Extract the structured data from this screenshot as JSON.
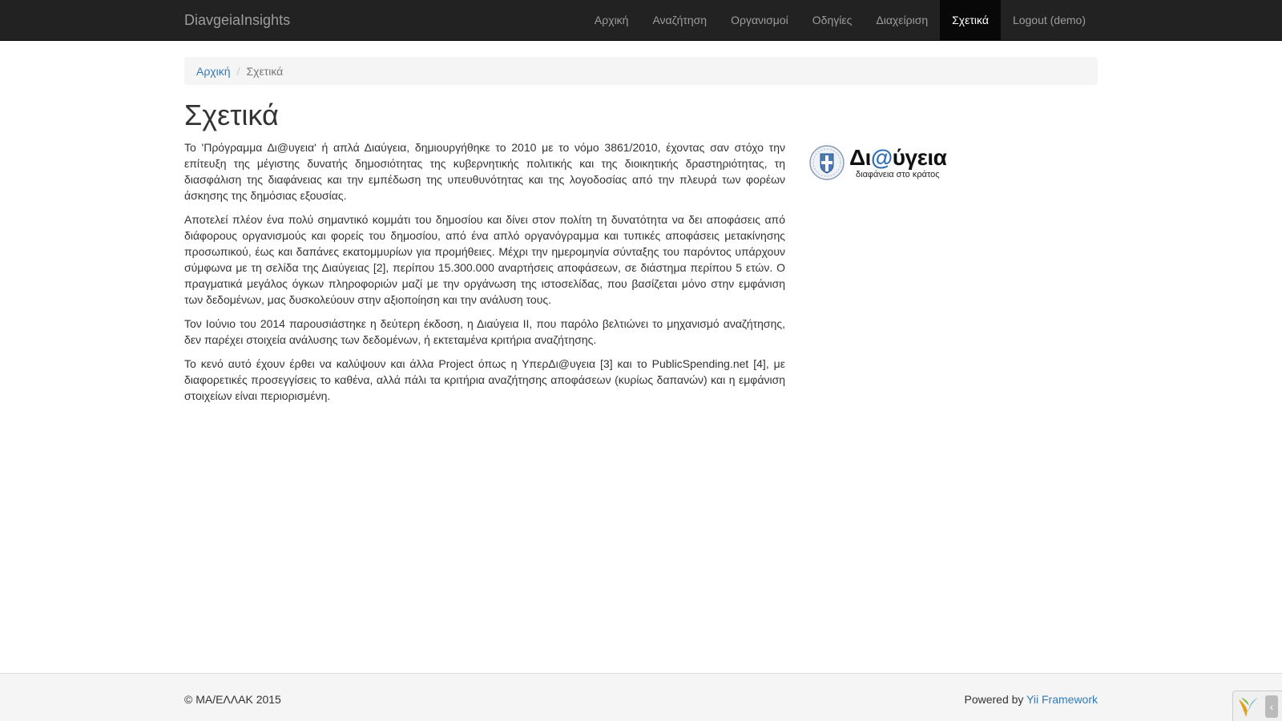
{
  "navbar": {
    "brand": "DiavgeiaInsights",
    "items": [
      {
        "label": "Αρχική",
        "active": false
      },
      {
        "label": "Αναζήτηση",
        "active": false
      },
      {
        "label": "Οργανισμοί",
        "active": false
      },
      {
        "label": "Οδηγίες",
        "active": false
      },
      {
        "label": "Διαχείριση",
        "active": false
      },
      {
        "label": "Σχετικά",
        "active": true
      },
      {
        "label": "Logout (demo)",
        "active": false
      }
    ]
  },
  "breadcrumb": {
    "home": "Αρχική",
    "separator": "/",
    "current": "Σχετικά"
  },
  "page": {
    "title": "Σχετικά",
    "paragraphs": [
      "Το 'Πρόγραμμα Δι@υγεια' ή απλά Διαύγεια, δημιουργήθηκε το 2010 με το νόμο 3861/2010, έχοντας σαν στόχο την επίτευξη της μέγιστης δυνατής δημοσιότητας της κυβερνητικής πολιτικής και της διοικητικής δραστηριότητας, τη διασφάλιση της διαφάνειας και την εμπέδωση της υπευθυνότητας και της λογοδοσίας από την πλευρά των φορέων άσκησης της δημόσιας εξουσίας.",
      "Αποτελεί πλέον ένα πολύ σημαντικό κομμάτι του δημοσίου και δίνει στον πολίτη τη δυνατότητα να δει αποφάσεις από διάφορους οργανισμούς και φορείς του δημοσίου, από ένα απλό οργανόγραμμα και τυπικές αποφάσεις μετακίνησης προσωπικού, έως και δαπάνες εκατομμυρίων για προμήθειες. Μέχρι την ημερομηνία σύνταξης του παρόντος υπάρχουν σύμφωνα με τη σελίδα της Διαύγειας [2], περίπου 15.300.000 αναρτήσεις αποφάσεων, σε διάστημα περίπου 5 ετών. Ο πραγματικά μεγάλος όγκων πληροφοριών μαζί με την οργάνωση της ιστοσελίδας, που βασίζεται μόνο στην εμφάνιση των δεδομένων, μας δυσκολεύουν στην αξιοποίηση και την ανάλυση τους.",
      "Τον Ιούνιο του 2014 παρουσιάστηκε η δεύτερη έκδοση, η Διαύγεια ΙΙ, που παρόλο βελτιώνει το μηχανισμό αναζήτησης, δεν παρέχει στοιχεία ανάλυσης των δεδομένων, ή εκτεταμένα κριτήρια αναζήτησης.",
      "Το κενό αυτό έχουν έρθει να καλύψουν και άλλα Project όπως η ΥπερΔι@υγεια [3] και το PublicSpending.net [4], με διαφορετικές προσεγγίσεις το καθένα, αλλά πάλι τα κριτήρια αναζήτησης αποφάσεων (κυρίως δαπανών) και η εμφάνιση στοιχείων είναι περιορισμένη."
    ]
  },
  "logo": {
    "name_prefix": "Δι",
    "name_at": "@",
    "name_suffix": "ύγεια",
    "tagline": "διαφάνεια στο κράτος",
    "accent_color": "#2f6db5"
  },
  "footer": {
    "copyright": "© ΜΑ/ΕΛΛΑΚ 2015",
    "powered_prefix": "Powered by ",
    "powered_link": "Yii Framework"
  },
  "icons": {
    "emblem": "greek-emblem-icon",
    "yii_logo": "yii-logo-icon",
    "toggle": "chevron-left-icon"
  }
}
